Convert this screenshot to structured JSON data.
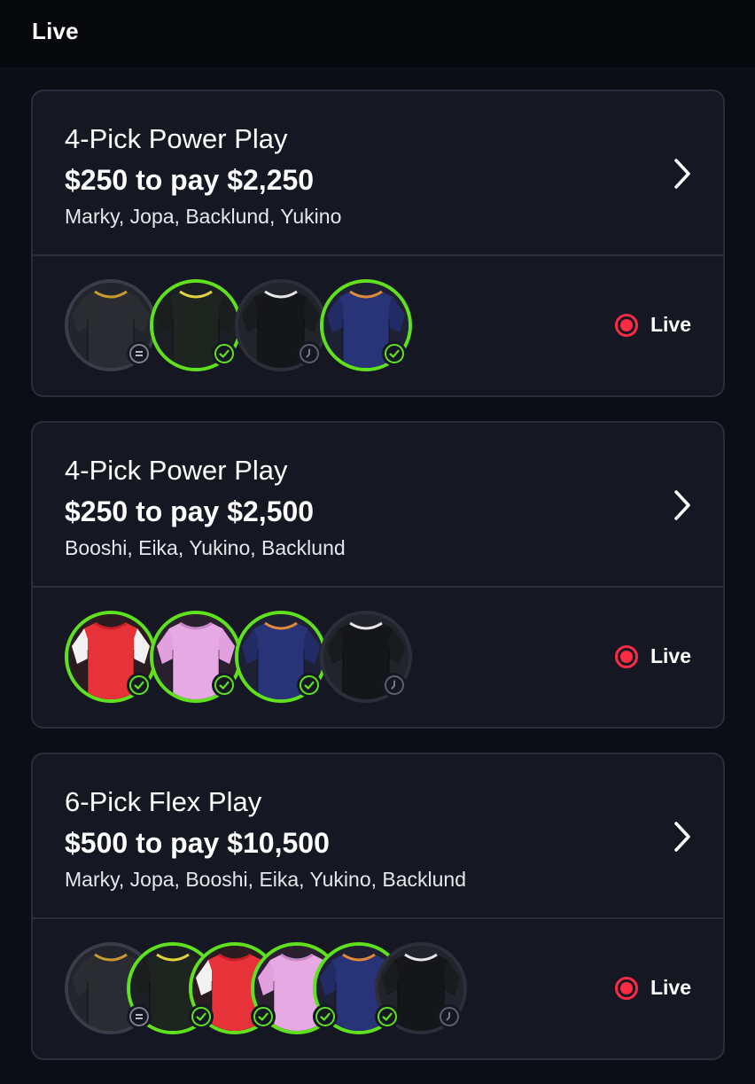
{
  "header": {
    "title": "Live"
  },
  "entries": [
    {
      "type": "4-Pick Power Play",
      "payout": "$250 to pay $2,250",
      "players": "Marky, Jopa, Backlund, Yukino",
      "status": "Live",
      "picks": [
        {
          "jersey": "dark-gray",
          "result": "push"
        },
        {
          "jersey": "black-yellow",
          "result": "hit"
        },
        {
          "jersey": "black",
          "result": "pending"
        },
        {
          "jersey": "navy",
          "result": "hit"
        }
      ]
    },
    {
      "type": "4-Pick Power Play",
      "payout": "$250 to pay $2,500",
      "players": "Booshi, Eika, Yukino, Backlund",
      "status": "Live",
      "picks": [
        {
          "jersey": "red-white",
          "result": "hit"
        },
        {
          "jersey": "pink",
          "result": "hit"
        },
        {
          "jersey": "navy",
          "result": "hit"
        },
        {
          "jersey": "black",
          "result": "pending"
        }
      ]
    },
    {
      "type": "6-Pick Flex Play",
      "payout": "$500 to pay $10,500",
      "players": "Marky, Jopa, Booshi, Eika, Yukino, Backlund",
      "status": "Live",
      "picks": [
        {
          "jersey": "dark-gray",
          "result": "push"
        },
        {
          "jersey": "black-yellow",
          "result": "hit"
        },
        {
          "jersey": "red-white",
          "result": "hit"
        },
        {
          "jersey": "pink",
          "result": "hit"
        },
        {
          "jersey": "navy",
          "result": "hit"
        },
        {
          "jersey": "black",
          "result": "pending"
        }
      ]
    }
  ],
  "colors": {
    "background": "#0c0e16",
    "card": "#151822",
    "border": "#2a2e3a",
    "win_ring": "#5fe11d",
    "live_red": "#ff2b45"
  }
}
